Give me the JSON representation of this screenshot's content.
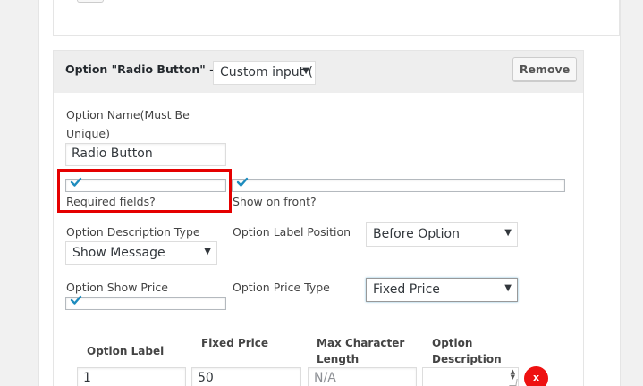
{
  "option": {
    "title": "Option \"Radio Button\" —",
    "type_select": "Custom input (",
    "remove_label": "Remove"
  },
  "fields": {
    "option_name_label": "Option Name(Must Be Unique)",
    "option_name_line1": "Option Name(Must Be",
    "option_name_line2": "Unique)",
    "option_name_value": "Radio Button",
    "required_label": "Required fields?",
    "required_checked": true,
    "show_front_label": "Show on front?",
    "show_front_checked": true,
    "desc_type_label": "Option Description Type",
    "desc_type_value": "Show Message",
    "label_position_label": "Option Label Position",
    "label_position_value": "Before Option",
    "show_price_label": "Option Show Price",
    "show_price_checked": true,
    "price_type_label": "Option Price Type",
    "price_type_value": "Fixed Price"
  },
  "table": {
    "headers": {
      "option_label": "Option Label",
      "fixed_price": "Fixed Price",
      "max_char_line1": "Max Character",
      "max_char_line2": "Length",
      "desc_line1": "Option",
      "desc_line2": "Description"
    },
    "rows": [
      {
        "label": "1",
        "price": "50",
        "max_length_placeholder": "N/A",
        "description": "",
        "delete_label": "x"
      }
    ]
  },
  "colors": {
    "highlight": "#e50000",
    "check": "#1e8cbe",
    "delete": "#ee1111"
  }
}
